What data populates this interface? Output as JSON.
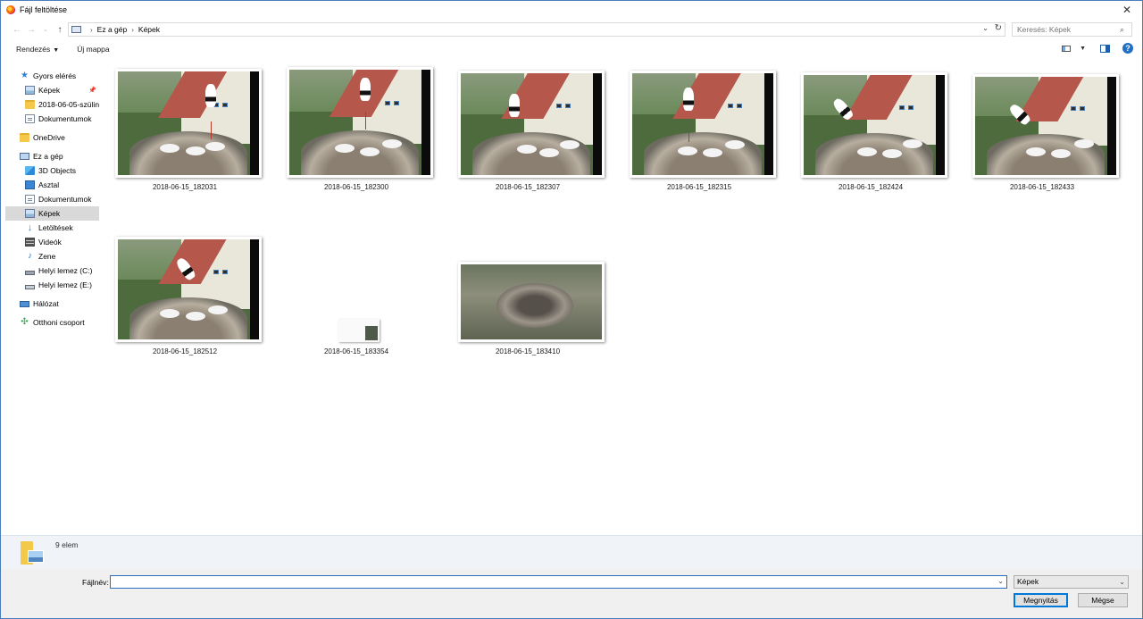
{
  "window": {
    "title": "Fájl feltöltése"
  },
  "address": {
    "breadcrumbs": [
      "Ez a gép",
      "Képek"
    ],
    "search_placeholder": "Keresés: Képek"
  },
  "toolbar": {
    "organize": "Rendezés",
    "new_folder": "Új mappa"
  },
  "sidebar": {
    "items": [
      {
        "label": "Gyors elérés",
        "icon": "star-icon"
      },
      {
        "label": "Képek",
        "icon": "pictures-icon"
      },
      {
        "label": "2018-06-05-szülinap",
        "icon": "folder-icon"
      },
      {
        "label": "Dokumentumok",
        "icon": "documents-icon"
      },
      {
        "label": "OneDrive",
        "icon": "folder-icon"
      },
      {
        "label": "Ez a gép",
        "icon": "pc-icon"
      },
      {
        "label": "3D Objects",
        "icon": "3d-objects-icon"
      },
      {
        "label": "Asztal",
        "icon": "desktop-icon"
      },
      {
        "label": "Dokumentumok",
        "icon": "documents-icon"
      },
      {
        "label": "Képek",
        "icon": "pictures-icon"
      },
      {
        "label": "Letöltések",
        "icon": "download-icon"
      },
      {
        "label": "Videók",
        "icon": "video-icon"
      },
      {
        "label": "Zene",
        "icon": "music-icon"
      },
      {
        "label": "Helyi lemez (C:)",
        "icon": "drive-icon"
      },
      {
        "label": "Helyi lemez (E:)",
        "icon": "drive-icon"
      },
      {
        "label": "Hálózat",
        "icon": "network-icon"
      },
      {
        "label": "Otthoni csoport",
        "icon": "homegroup-icon"
      }
    ]
  },
  "files": [
    {
      "name": "2018-06-15_182031"
    },
    {
      "name": "2018-06-15_182300"
    },
    {
      "name": "2018-06-15_182307"
    },
    {
      "name": "2018-06-15_182315"
    },
    {
      "name": "2018-06-15_182424"
    },
    {
      "name": "2018-06-15_182433"
    },
    {
      "name": "2018-06-15_182512"
    },
    {
      "name": "2018-06-15_183354"
    },
    {
      "name": "2018-06-15_183410"
    }
  ],
  "status": {
    "item_count": "9 elem"
  },
  "footer": {
    "filename_label": "Fájlnév:",
    "filename_value": "",
    "file_type": "Képek",
    "open_button": "Megnyitás",
    "cancel_button": "Mégse"
  },
  "colors": {
    "accent": "#0078d7",
    "selected_bg": "#d9d9d9"
  }
}
